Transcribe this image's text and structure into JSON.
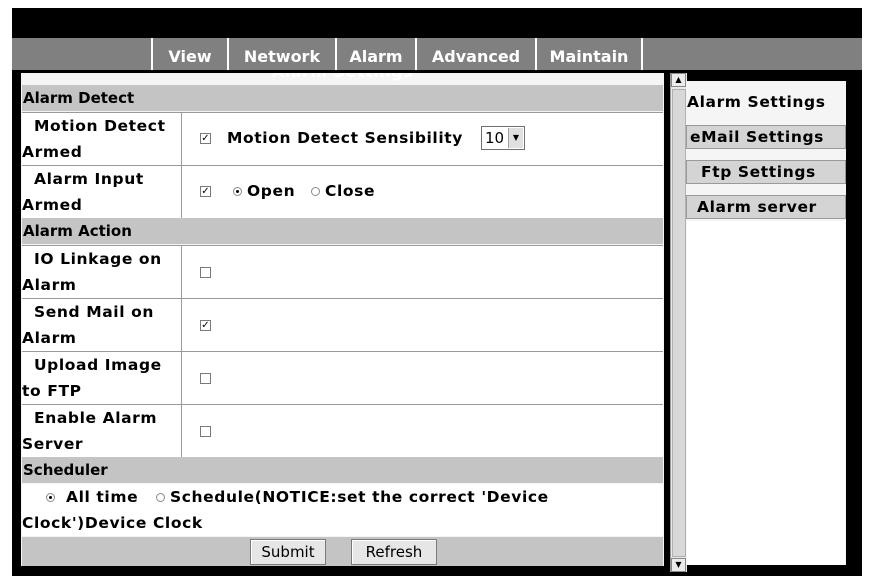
{
  "nav": {
    "items": [
      {
        "label": "View"
      },
      {
        "label": "Network"
      },
      {
        "label": "Alarm"
      },
      {
        "label": "Advanced"
      },
      {
        "label": "Maintain"
      }
    ]
  },
  "panel": {
    "title": "Alarm Settings",
    "sections": {
      "detect": "Alarm Detect",
      "action": "Alarm Action",
      "scheduler": "Scheduler"
    },
    "motion": {
      "label_line1": "Motion Detect",
      "label_line2": "Armed",
      "checked": true,
      "sensibility_label": "Motion Detect Sensibility",
      "sensibility_value": "10"
    },
    "alarm_input": {
      "label_line1": "Alarm Input",
      "label_line2": "Armed",
      "checked": true,
      "open_label": "Open",
      "close_label": "Close",
      "selected": "Open"
    },
    "io_linkage": {
      "label_line1": "IO Linkage on",
      "label_line2": "Alarm",
      "checked": false
    },
    "send_mail": {
      "label_line1": "Send Mail on",
      "label_line2": "Alarm",
      "checked": true
    },
    "upload_ftp": {
      "label_line1": "Upload Image",
      "label_line2": "to FTP",
      "checked": false
    },
    "alarm_server": {
      "label_line1": "Enable Alarm",
      "label_line2": "Server",
      "checked": false
    },
    "scheduler": {
      "all_time_label": "All time",
      "schedule_label": "Schedule(NOTICE:set the correct 'Device",
      "schedule_line2": "Clock')Device Clock",
      "selected": "All time"
    },
    "buttons": {
      "submit": "Submit",
      "refresh": "Refresh"
    }
  },
  "sidebar": {
    "items": [
      {
        "label": "Alarm Settings",
        "active": true
      },
      {
        "label": "eMail Settings",
        "active": false
      },
      {
        "label": "Ftp Settings",
        "active": false
      },
      {
        "label": "Alarm server",
        "active": false
      }
    ]
  },
  "icons": {
    "check": "✓-checkmark",
    "dropdown": "chevron-down-icon",
    "scroll_up": "arrow-up-icon",
    "scroll_down": "arrow-down-icon"
  }
}
